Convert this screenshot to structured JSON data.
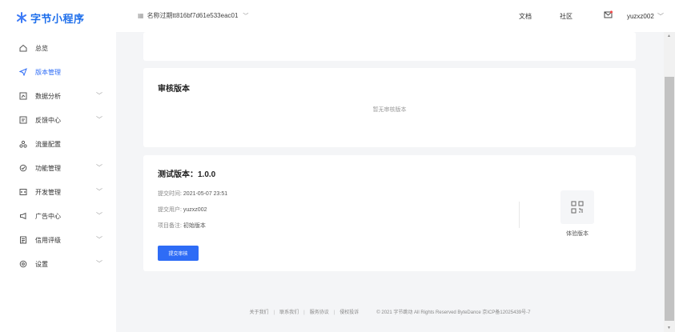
{
  "brand": {
    "name": "字节小程序"
  },
  "topbar": {
    "app_name": "名称过期tt816bf7d61e533eac01",
    "links": {
      "docs": "文档",
      "community": "社区",
      "user": "yuzxz002"
    }
  },
  "sidebar": {
    "items": [
      {
        "label": "总览",
        "icon": "home-icon",
        "chevron": false,
        "active": false
      },
      {
        "label": "版本管理",
        "icon": "send-icon",
        "chevron": false,
        "active": true
      },
      {
        "label": "数据分析",
        "icon": "chart-icon",
        "chevron": true,
        "active": false
      },
      {
        "label": "反馈中心",
        "icon": "message-icon",
        "chevron": true,
        "active": false
      },
      {
        "label": "流量配置",
        "icon": "traffic-icon",
        "chevron": false,
        "active": false
      },
      {
        "label": "功能管理",
        "icon": "settings-icon",
        "chevron": true,
        "active": false
      },
      {
        "label": "开发管理",
        "icon": "code-icon",
        "chevron": true,
        "active": false
      },
      {
        "label": "广告中心",
        "icon": "megaphone-icon",
        "chevron": true,
        "active": false
      },
      {
        "label": "信用评级",
        "icon": "document-icon",
        "chevron": true,
        "active": false
      },
      {
        "label": "设置",
        "icon": "gear-icon",
        "chevron": true,
        "active": false
      }
    ]
  },
  "review": {
    "title": "审核版本",
    "empty": "暂无审核版本"
  },
  "test": {
    "title": "测试版本：1.0.0",
    "submit_time_label": "提交时间:",
    "submit_time": "2021-05-07 23:51",
    "submit_user_label": "提交用户:",
    "submit_user": "yuzxz002",
    "remark_label": "项目备注:",
    "remark": "初始版本",
    "submit_button": "提交审核",
    "experience_label": "体验版本"
  },
  "footer": {
    "about": "关于我们",
    "contact": "联系我们",
    "agreement": "服务协议",
    "complaint": "侵权投诉",
    "copyright": "© 2021 字节跳动 All Rights Reserved ByteDance 京ICP备12025439号-7"
  },
  "colors": {
    "accent": "#2e6cf6",
    "background": "#f4f5f7"
  }
}
